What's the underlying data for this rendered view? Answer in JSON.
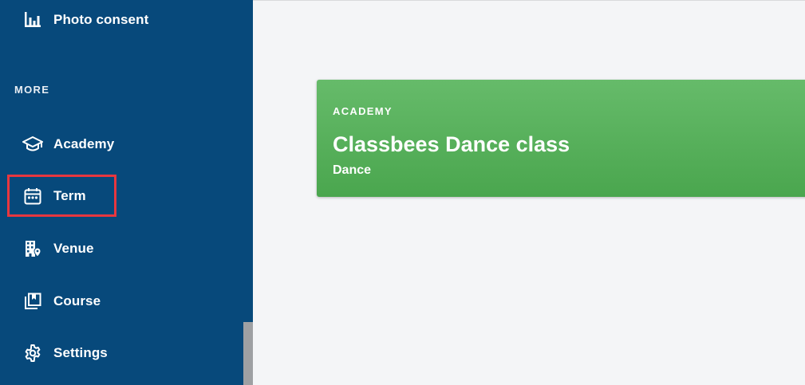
{
  "sidebar": {
    "top_item": {
      "label": "Photo consent",
      "icon": "bar-chart-icon"
    },
    "section_label": "MORE",
    "items": [
      {
        "label": "Academy",
        "icon": "graduation-cap-icon"
      },
      {
        "label": "Term",
        "icon": "calendar-icon",
        "highlighted": true
      },
      {
        "label": "Venue",
        "icon": "building-location-icon"
      },
      {
        "label": "Course",
        "icon": "book-collection-icon"
      },
      {
        "label": "Settings",
        "icon": "gear-icon"
      }
    ]
  },
  "card": {
    "eyebrow": "ACADEMY",
    "title": "Classbees Dance class",
    "subtitle": "Dance"
  },
  "colors": {
    "sidebar": "#07497b",
    "card_green": "#5cb55f",
    "highlight": "#e8373f",
    "background": "#f4f5f7"
  }
}
